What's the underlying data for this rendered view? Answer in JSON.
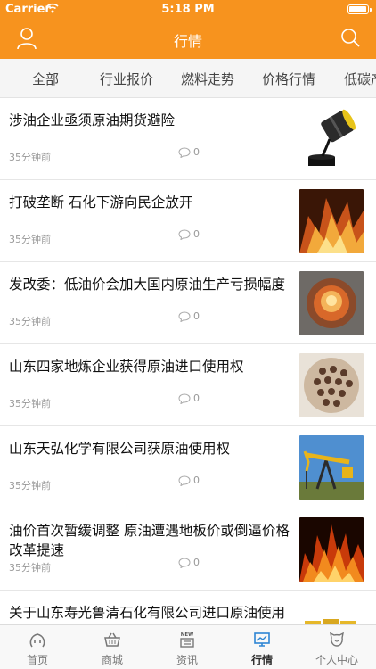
{
  "status": {
    "carrier": "Carrier",
    "time": "5:18 PM",
    "battery_level": 0.95
  },
  "nav": {
    "title": "行情",
    "user_icon": "user-icon",
    "search_icon": "search-icon"
  },
  "tabs": [
    {
      "label": "全部"
    },
    {
      "label": "行业报价"
    },
    {
      "label": "燃料走势"
    },
    {
      "label": "价格行情"
    },
    {
      "label": "低碳产"
    }
  ],
  "articles": [
    {
      "title": "涉油企业亟须原油期货避险",
      "time": "35分钟前",
      "comments": "0",
      "thumb": "oil-barrel"
    },
    {
      "title": "打破垄断 石化下游向民企放开",
      "time": "35分钟前",
      "comments": "0",
      "thumb": "fire-wood"
    },
    {
      "title": "发改委：低油价会加大国内原油生产亏损幅度",
      "time": "35分钟前",
      "comments": "0",
      "thumb": "burning-coal"
    },
    {
      "title": "山东四家地炼企业获得原油进口使用权",
      "time": "35分钟前",
      "comments": "0",
      "thumb": "coal-briquette"
    },
    {
      "title": "山东天弘化学有限公司获原油使用权",
      "time": "35分钟前",
      "comments": "0",
      "thumb": "oil-pump"
    },
    {
      "title": "油价首次暂缓调整 原油遭遇地板价或倒逼价格改革提速",
      "time": "35分钟前",
      "comments": "0",
      "thumb": "flames"
    },
    {
      "title": "关于山东寿光鲁清石化有限公司进口原油使用核查评估情况的公示",
      "time": "",
      "comments": "",
      "thumb": "gold-barrels"
    }
  ],
  "tabbar": [
    {
      "label": "首页",
      "icon": "home-icon"
    },
    {
      "label": "商城",
      "icon": "basket-icon"
    },
    {
      "label": "资讯",
      "icon": "news-icon",
      "badge": "NEW"
    },
    {
      "label": "行情",
      "icon": "monitor-chart-icon",
      "active": true
    },
    {
      "label": "个人中心",
      "icon": "profile-icon"
    }
  ],
  "colors": {
    "accent": "#F7931E",
    "tab_bg": "#F5F5F5"
  }
}
